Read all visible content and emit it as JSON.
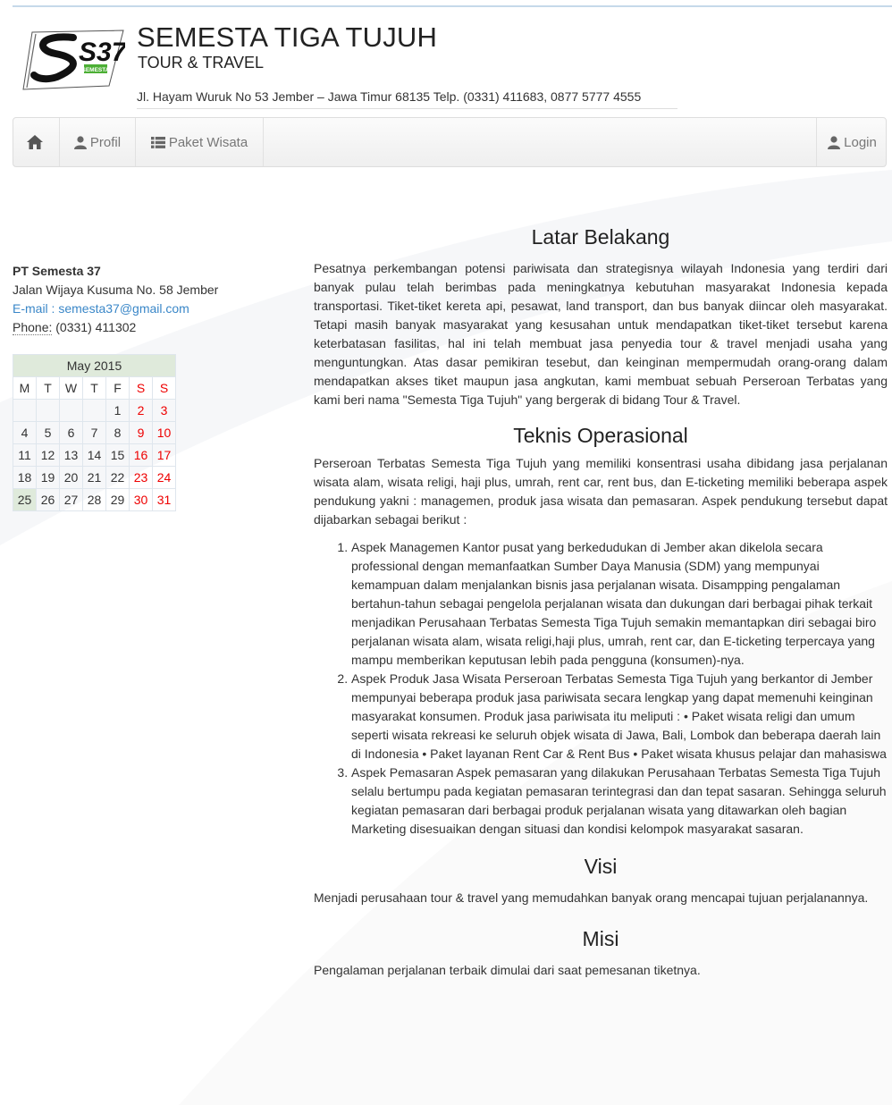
{
  "header": {
    "logo_text": "S37",
    "logo_badge": "SEMESTA",
    "title": "SEMESTA TIGA TUJUH",
    "subtitle": "TOUR & TRAVEL",
    "address": "Jl. Hayam Wuruk No 53 Jember – Jawa Timur 68135 Telp. (0331) 411683, 0877 5777 4555"
  },
  "nav": {
    "home_icon": "home-icon",
    "profil": "Profil",
    "paket": "Paket Wisata",
    "login": "Login"
  },
  "sidebar": {
    "company_name": "PT Semesta 37",
    "street": "Jalan Wijaya Kusuma No. 58 Jember",
    "email_label": "E-mail : ",
    "email": "semesta37@gmail.com",
    "phone_label": "Phone:",
    "phone": " (0331) 411302"
  },
  "calendar": {
    "month": "May 2015",
    "days": [
      "M",
      "T",
      "W",
      "T",
      "F",
      "S",
      "S"
    ],
    "weeks": [
      [
        "",
        "",
        "",
        "",
        "1",
        "2",
        "3"
      ],
      [
        "4",
        "5",
        "6",
        "7",
        "8",
        "9",
        "10"
      ],
      [
        "11",
        "12",
        "13",
        "14",
        "15",
        "16",
        "17"
      ],
      [
        "18",
        "19",
        "20",
        "21",
        "22",
        "23",
        "24"
      ],
      [
        "25",
        "26",
        "27",
        "28",
        "29",
        "30",
        "31"
      ]
    ],
    "today": "25",
    "weekend_color": "#e00000"
  },
  "content": {
    "latar_title": "Latar Belakang",
    "latar_text": "Pesatnya perkembangan potensi pariwisata dan strategisnya wilayah Indonesia yang terdiri dari banyak pulau telah berimbas pada meningkatnya kebutuhan masyarakat Indonesia kepada transportasi. Tiket-tiket kereta api, pesawat, land transport, dan bus banyak diincar oleh masyarakat. Tetapi masih banyak masyarakat yang kesusahan untuk mendapatkan tiket-tiket tersebut karena keterbatasan fasilitas, hal ini telah membuat jasa penyedia tour & travel menjadi usaha yang menguntungkan. Atas dasar pemikiran tesebut, dan keinginan mempermudah orang-orang dalam mendapatkan akses tiket maupun jasa angkutan, kami membuat sebuah Perseroan Terbatas yang kami beri nama \"Semesta Tiga Tujuh\" yang bergerak di bidang Tour & Travel.",
    "teknis_title": "Teknis Operasional",
    "teknis_text": "Perseroan Terbatas Semesta Tiga Tujuh yang memiliki konsentrasi usaha dibidang jasa perjalanan wisata alam, wisata religi, haji plus, umrah, rent car, rent bus, dan E-ticketing memiliki beberapa aspek pendukung yakni : managemen, produk jasa wisata dan pemasaran. Aspek pendukung tersebut dapat dijabarkan sebagai berikut :",
    "aspek": [
      "Aspek Managemen Kantor pusat yang berkedudukan di Jember akan dikelola secara professional dengan memanfaatkan Sumber Daya Manusia (SDM) yang mempunyai kemampuan dalam menjalankan bisnis jasa perjalanan wisata. Disampping pengalaman bertahun-tahun sebagai pengelola perjalanan wisata dan dukungan dari berbagai pihak terkait menjadikan Perusahaan Terbatas Semesta Tiga Tujuh semakin memantapkan diri sebagai biro perjalanan wisata alam, wisata religi,haji plus, umrah, rent car, dan E-ticketing terpercaya yang mampu memberikan keputusan lebih pada pengguna (konsumen)-nya.",
      "Aspek Produk Jasa Wisata Perseroan Terbatas Semesta Tiga Tujuh yang berkantor di Jember mempunyai beberapa produk jasa pariwisata secara lengkap yang dapat memenuhi keinginan masyarakat konsumen. Produk jasa pariwisata itu meliputi : • Paket wisata religi dan umum seperti wisata rekreasi ke seluruh objek wisata di Jawa, Bali, Lombok dan beberapa daerah lain di Indonesia • Paket layanan Rent Car & Rent Bus • Paket wisata khusus pelajar dan mahasiswa",
      "Aspek Pemasaran Aspek pemasaran yang dilakukan Perusahaan Terbatas Semesta Tiga Tujuh selalu bertumpu pada kegiatan pemasaran terintegrasi dan dan tepat sasaran. Sehingga seluruh kegiatan pemasaran dari berbagai produk perjalanan wisata yang ditawarkan oleh bagian Marketing disesuaikan dengan situasi dan kondisi kelompok masyarakat sasaran."
    ],
    "visi_title": "Visi",
    "visi_text": "Menjadi perusahaan tour & travel yang memudahkan banyak orang mencapai tujuan perjalanannya.",
    "misi_title": "Misi",
    "misi_text": "Pengalaman perjalanan terbaik dimulai dari saat pemesanan tiketnya."
  }
}
